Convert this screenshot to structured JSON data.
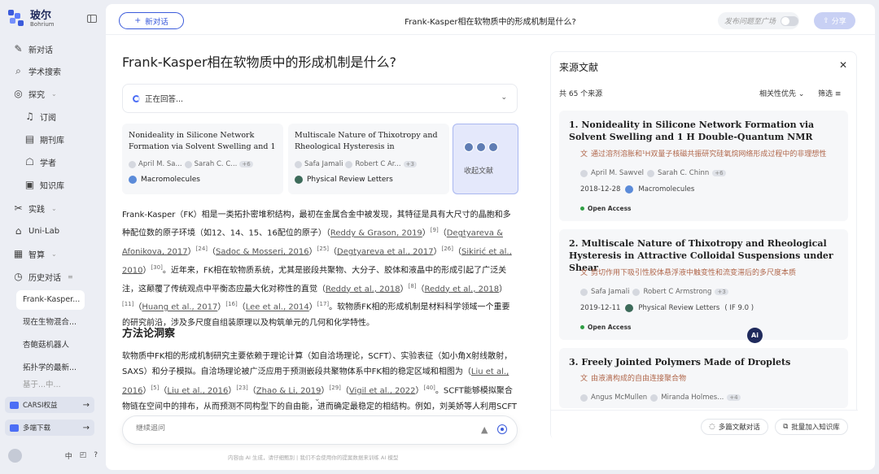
{
  "app": {
    "name": "玻尔",
    "name_en": "Bohrium"
  },
  "sidebar": {
    "items": [
      {
        "label": "新对话",
        "icon": "edit-icon"
      },
      {
        "label": "学术搜索",
        "icon": "search-icon"
      },
      {
        "label": "探究",
        "icon": "explore-icon"
      },
      {
        "label": "订阅",
        "icon": "bell-icon"
      },
      {
        "label": "期刊库",
        "icon": "journal-icon"
      },
      {
        "label": "学者",
        "icon": "scholar-icon"
      },
      {
        "label": "知识库",
        "icon": "knowledge-icon"
      },
      {
        "label": "实践",
        "icon": "practice-icon"
      },
      {
        "label": "Uni-Lab",
        "icon": "lab-icon"
      },
      {
        "label": "智算",
        "icon": "compute-icon"
      },
      {
        "label": "历史对话",
        "icon": "history-icon"
      }
    ],
    "history": [
      "Frank-Kasper...",
      "现在生物混合...",
      "杏鲍菇机器人",
      "拓扑学的最新...",
      "基于...中..."
    ],
    "promos": [
      {
        "label": "CARSI权益"
      },
      {
        "label": "多端下载"
      }
    ],
    "bottom": {
      "lang": "中"
    }
  },
  "topbar": {
    "new_chat": "新对话",
    "title": "Frank-Kasper相在软物质中的形成机制是什么?",
    "publish": "发布问题至广场",
    "share": "分享"
  },
  "main": {
    "question": "Frank-Kasper相在软物质中的形成机制是什么?",
    "status": "正在回答...",
    "ref_cards": [
      {
        "title": "Nonideality in Silicone Network Formation via Solvent Swelling and 1 ...",
        "author1": "April M. Sa...",
        "author2": "Sarah C. C...",
        "more": "+6",
        "journal": "Macromolecules",
        "jcolor": "#5b8bd9"
      },
      {
        "title": "Multiscale Nature of Thixotropy and Rheological Hysteresis in Attractive...",
        "author1": "Safa Jamali",
        "author2": "Robert C Ar...",
        "more": "+3",
        "journal": "Physical Review Letters",
        "jcolor": "#3d6b5a"
      }
    ],
    "collapse_label": "收起文献",
    "p1": {
      "t1": "Frank-Kasper（FK）相是一类拓扑密堆积结构，最初在金属合金中被发现，其特征是具有大尺寸的晶胞和多种配位数的原子环境（如12、14、15、16配位的原子）（",
      "c1": "Reddy & Grason, 2019",
      "s1": "[9]",
      "c2": "Degtyareva & Afonikova, 2017",
      "s2": "[24]",
      "c3": "Sadoc & Mosseri, 2016",
      "s3": "[25]",
      "c4": "Degtyareva et al., 2017",
      "s4": "[26]",
      "c5": "Sikirić et al., 2010",
      "s5": "[30]",
      "t2": "。近年来，FK相在软物质系统，尤其是嵌段共聚物、大分子、胶体和液晶中的形成引起了广泛关注，这颠覆了传统观点中平衡态应最大化对称性的直觉（",
      "c6": "Reddy et al., 2018",
      "s6": "[8]",
      "c7": "Reddy et al., 2018",
      "s7": "[11]",
      "c8": "Huang et al., 2017",
      "s8": "[16]",
      "c9": "Lee et al., 2014",
      "s9": "[17]",
      "t3": "。软物质FK相的形成机制是材料科学领域一个重要的研究前沿，涉及多尺度自组装原理以及构筑单元的几何和化学特性。"
    },
    "section": "方法论洞察",
    "p2": {
      "t1": "软物质中FK相的形成机制研究主要依赖于理论计算（如自洽场理论，SCFT）、实验表征（如小角X射线散射，SAXS）和分子模拟。自洽场理论被广泛应用于预测嵌段共聚物体系中FK相的稳定区域和相图为（",
      "c1": "Liu et al., 2016",
      "s1": "[5]",
      "c2": "Liu et al., 2016",
      "s2": "[23]",
      "c3": "Zhao & Li, 2019",
      "s3": "[29]",
      "c4": "Vigil et al., 2022",
      "s4": "[40]",
      "t2": "。SCFT能够模拟聚合物链在空间中的排布，从而预测不同构型下的自由能，进而确定最稳定的相结构。例如，刘美娇等人利用SCFT研究了AB二嵌段共聚物三元混合物中FK相的出现和稳定性，发现σ相在相图中占据"
    },
    "follow_placeholder": "继续追问",
    "disclaimer": "内容由 AI 生成，请仔细甄别 | 我们不会使用你的提案数据来训练 AI 模型"
  },
  "sources": {
    "header": "来源文献",
    "count": "共 65 个来源",
    "sort": "相关性优先",
    "filter": "筛选",
    "items": [
      {
        "num": "1.",
        "title": "Nonideality in Silicone Network Formation via Solvent Swelling and 1 H Double-Quantum NMR",
        "cn": "通过溶剂溶胀和¹H双量子核磁共振研究硅氧烷网络形成过程中的非理想性",
        "a1": "April M. Sawvel",
        "a2": "Sarah C. Chinn",
        "more": "+6",
        "date": "2018-12-28",
        "journal": "Macromolecules",
        "jcolor": "#5b8bd9",
        "if": "",
        "oa": "Open Access"
      },
      {
        "num": "2.",
        "title": "Multiscale Nature of Thixotropy and Rheological Hysteresis in Attractive Colloidal Suspensions under Shear",
        "cn": "剪切作用下吸引性胶体悬浮液中触变性和流变滞后的多尺度本质",
        "a1": "Safa Jamali",
        "a2": "Robert C Armstrong",
        "more": "+3",
        "date": "2019-12-11",
        "journal": "Physical Review Letters",
        "jcolor": "#3d6b5a",
        "if": "( IF 9.0 )",
        "oa": "Open Access"
      },
      {
        "num": "3.",
        "title": "Freely Jointed Polymers Made of Droplets",
        "cn": "由液滴构成的自由连接聚合物",
        "a1": "Angus McMullen",
        "a2": "Miranda Holmes...",
        "more": "+4"
      }
    ],
    "footer": {
      "chat": "多篇文献对话",
      "add": "批量加入知识库"
    },
    "ai_badge": "Ai"
  }
}
